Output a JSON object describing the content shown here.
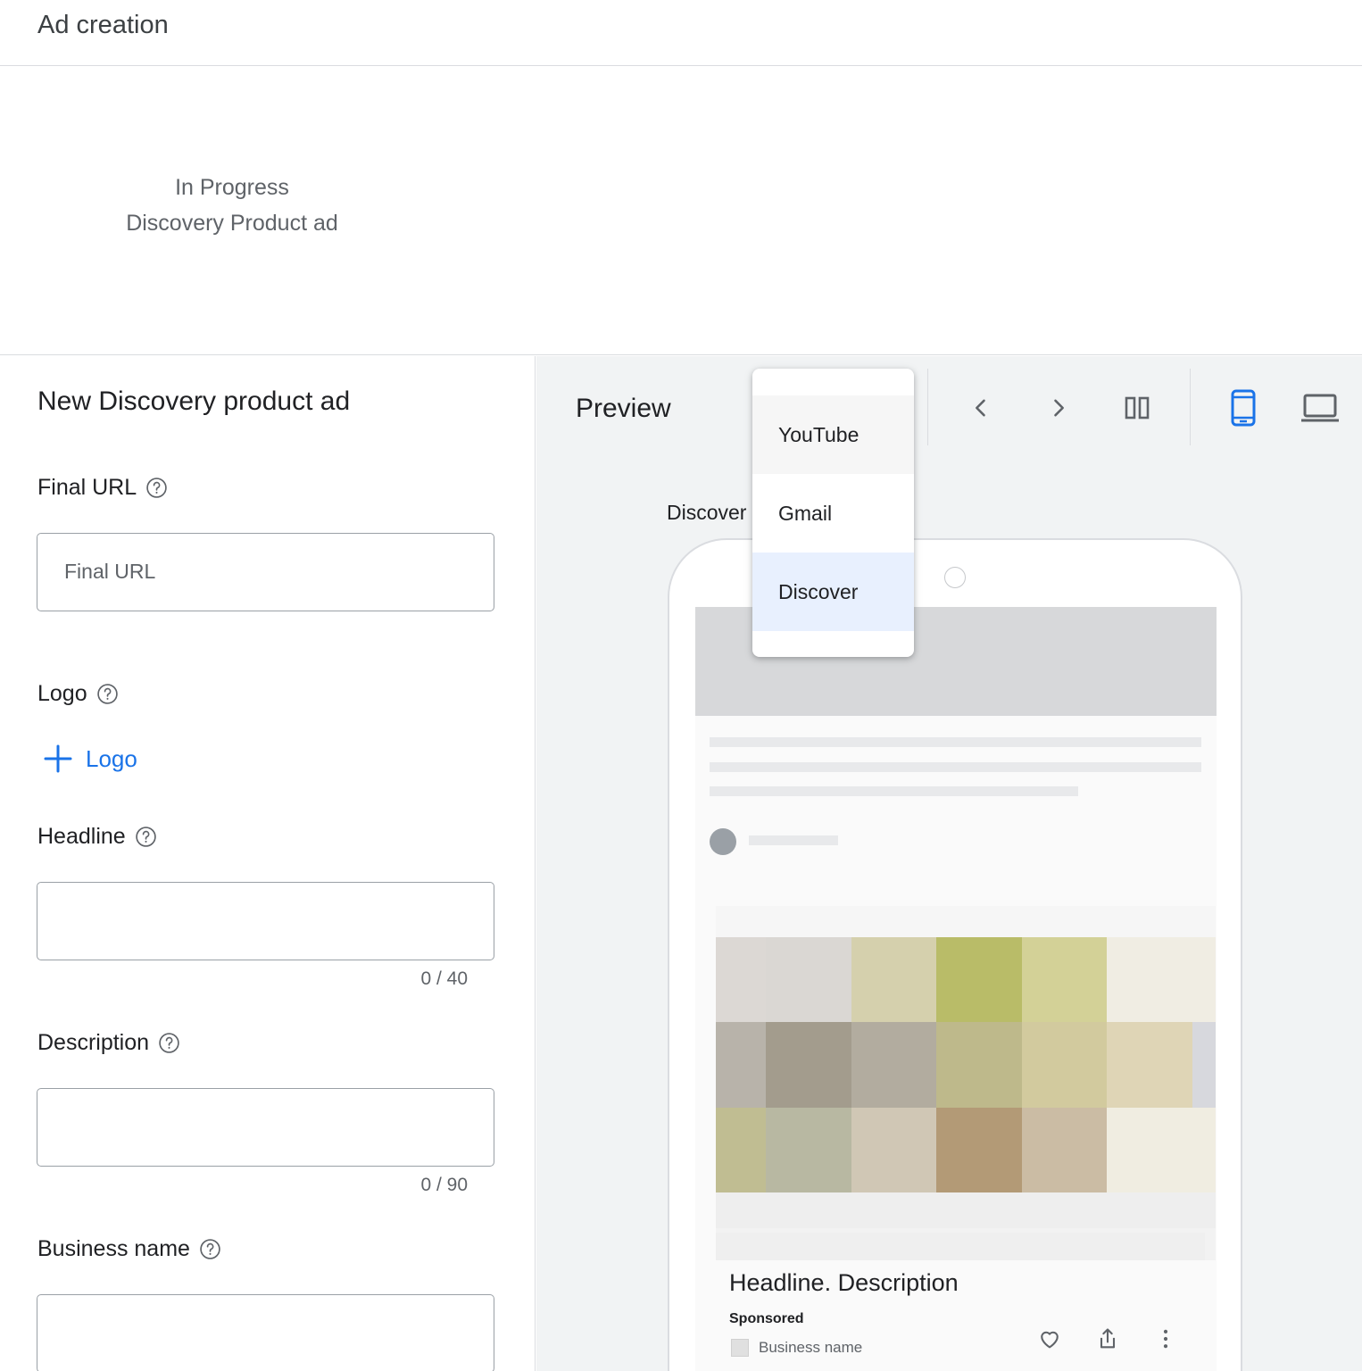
{
  "header": {
    "title": "Ad creation"
  },
  "progress": {
    "status": "In Progress",
    "ad_type": "Discovery Product ad"
  },
  "form": {
    "title": "New Discovery product ad",
    "final_url": {
      "label": "Final URL",
      "placeholder": "Final URL",
      "value": ""
    },
    "logo": {
      "label": "Logo",
      "add_label": "Logo"
    },
    "headline": {
      "label": "Headline",
      "value": "",
      "counter": "0 / 40"
    },
    "description": {
      "label": "Description",
      "value": "",
      "counter": "0 / 90"
    },
    "business_name": {
      "label": "Business name",
      "value": ""
    }
  },
  "preview": {
    "title": "Preview",
    "platform_label": "Discover",
    "platform_options": [
      "YouTube",
      "Gmail",
      "Discover"
    ],
    "selected_platform": "Discover",
    "toolbar_icons": [
      "chevron-left-icon",
      "chevron-right-icon",
      "view-columns-icon",
      "phone-icon",
      "laptop-icon"
    ],
    "active_device": "phone",
    "ad": {
      "headline": "Headline. Description",
      "sponsored": "Sponsored",
      "business_name": "Business name",
      "actions": [
        "heart-icon",
        "share-icon",
        "more-vert-icon"
      ]
    }
  },
  "colors": {
    "accent": "#1a73e8",
    "selected_option_bg": "#e8f0fe",
    "preview_bg": "#f1f3f4",
    "border": "#dadce0"
  }
}
